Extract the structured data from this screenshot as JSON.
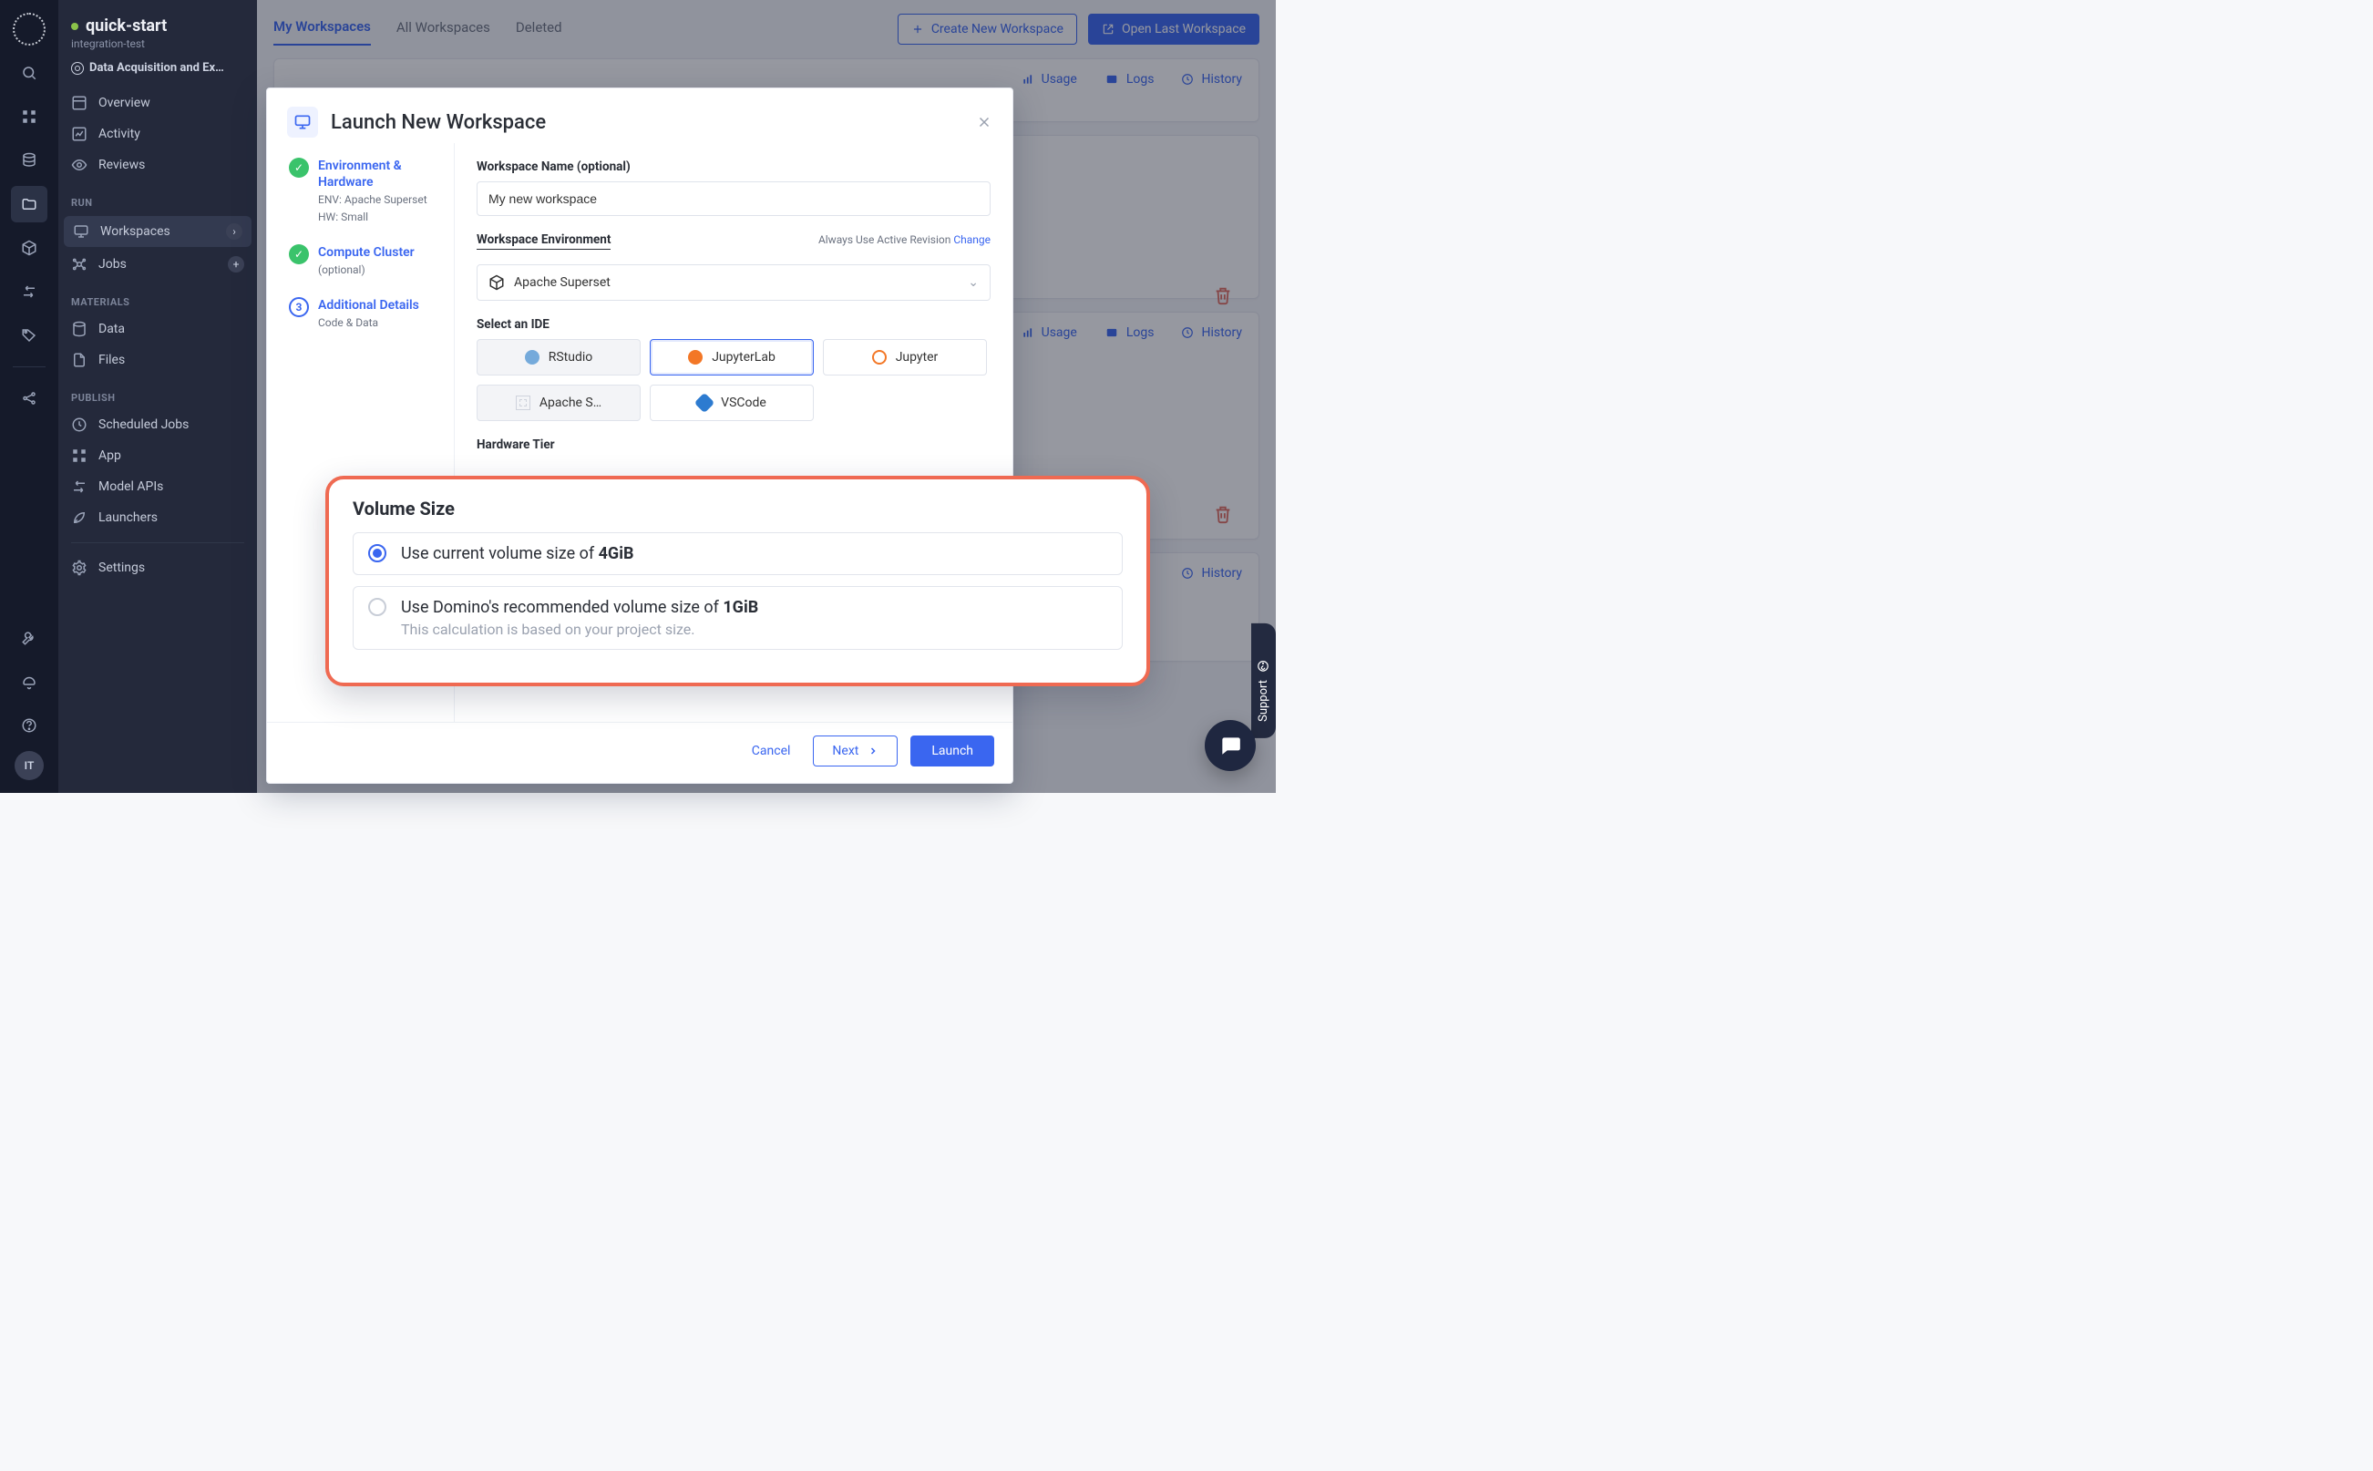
{
  "project": {
    "title": "quick-start",
    "subtitle": "integration-test",
    "path": "Data Acquisition and Ex…"
  },
  "sidebar": {
    "nav": {
      "overview": "Overview",
      "activity": "Activity",
      "reviews": "Reviews"
    },
    "sections": {
      "run": "RUN",
      "materials": "MATERIALS",
      "publish": "PUBLISH"
    },
    "run": {
      "workspaces": "Workspaces",
      "jobs": "Jobs"
    },
    "materials": {
      "data": "Data",
      "files": "Files"
    },
    "publish": {
      "scheduled_jobs": "Scheduled Jobs",
      "app": "App",
      "model_apis": "Model APIs",
      "launchers": "Launchers"
    },
    "settings": "Settings"
  },
  "tabs": {
    "my_workspaces": "My Workspaces",
    "all_workspaces": "All Workspaces",
    "deleted": "Deleted"
  },
  "actions": {
    "create": "Create New Workspace",
    "open_last": "Open Last Workspace"
  },
  "card_links": {
    "usage": "Usage",
    "logs": "Logs",
    "history": "History"
  },
  "modal": {
    "title": "Launch New Workspace",
    "steps": {
      "one": {
        "title": "Environment & Hardware",
        "sub1": "ENV: Apache Superset",
        "sub2": "HW: Small"
      },
      "two": {
        "title": "Compute Cluster",
        "sub1": "(optional)"
      },
      "three": {
        "title": "Additional Details",
        "sub1": "Code & Data",
        "num": "3"
      }
    },
    "form": {
      "ws_name_label": "Workspace Name (optional)",
      "ws_name_value": "My new workspace",
      "env_label": "Workspace Environment",
      "env_hint_prefix": "Always Use Active Revision ",
      "env_hint_link": "Change",
      "env_value": "Apache Superset",
      "ide_label": "Select an IDE",
      "ide": {
        "rstudio": "RStudio",
        "jlab": "JupyterLab",
        "jupy": "Jupyter",
        "apache": "Apache S…",
        "vscode": "VSCode"
      },
      "hw_label": "Hardware Tier"
    },
    "footer": {
      "cancel": "Cancel",
      "next": "Next",
      "launch": "Launch"
    }
  },
  "volume": {
    "title": "Volume Size",
    "opt1_pre": "Use current volume size of ",
    "opt1_val": "4GiB",
    "opt2_pre": "Use Domino's recommended volume size of ",
    "opt2_val": "1GiB",
    "opt2_sub": "This calculation is based on your project size."
  },
  "misc": {
    "support": "Support",
    "avatar": "IT"
  }
}
